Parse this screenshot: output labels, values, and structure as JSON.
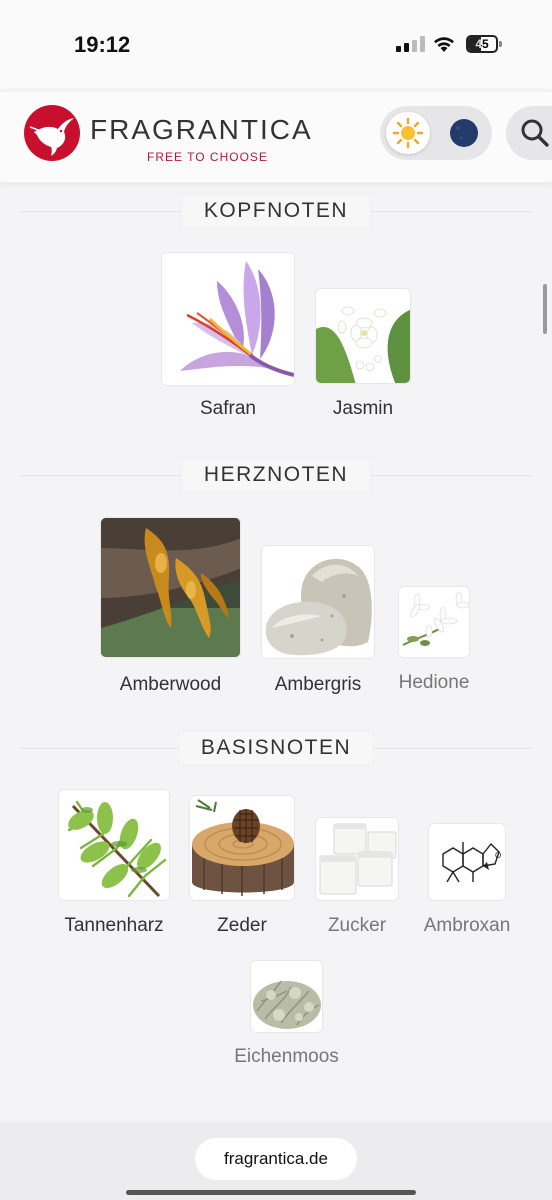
{
  "status": {
    "time": "19:12",
    "battery": "45",
    "battery_level": 0.45
  },
  "header": {
    "brand": "FRAGRANTICA",
    "tagline": "FREE TO CHOOSE"
  },
  "sections": {
    "top": {
      "title": "KOPFNOTEN",
      "notes": [
        {
          "name": "Safran",
          "icon": "saffron-flower-image"
        },
        {
          "name": "Jasmin",
          "icon": "jasmine-flower-image"
        }
      ]
    },
    "heart": {
      "title": "HERZNOTEN",
      "notes": [
        {
          "name": "Amberwood",
          "icon": "amber-resin-image"
        },
        {
          "name": "Ambergris",
          "icon": "ambergris-stone-image"
        },
        {
          "name": "Hedione",
          "icon": "white-blossom-image"
        }
      ]
    },
    "base": {
      "title": "BASISNOTEN",
      "notes": [
        {
          "name": "Tannenharz",
          "icon": "fir-branch-image"
        },
        {
          "name": "Zeder",
          "icon": "cedar-log-image"
        },
        {
          "name": "Zucker",
          "icon": "sugar-cubes-image"
        },
        {
          "name": "Ambroxan",
          "icon": "molecule-structure-image"
        },
        {
          "name": "Eichenmoos",
          "icon": "oakmoss-image"
        }
      ]
    }
  },
  "footer": {
    "url": "fragrantica.de"
  },
  "colors": {
    "brand_red": "#c8102e",
    "tagline_red": "#b8193a",
    "background": "#f4f3f5"
  }
}
